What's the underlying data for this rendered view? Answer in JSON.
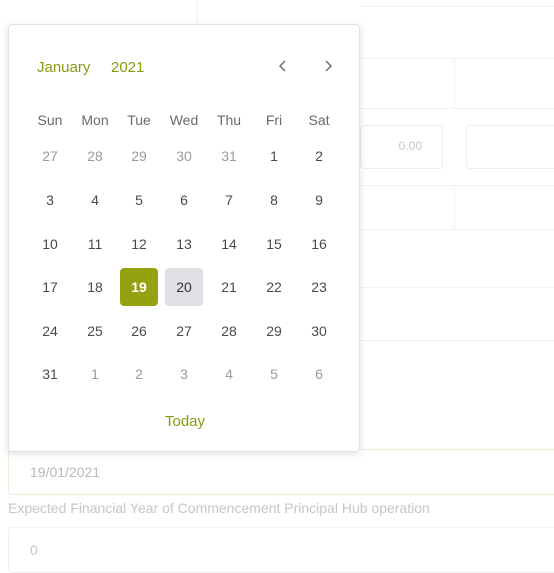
{
  "colors": {
    "accent": "#96a10f",
    "accent_text": "#8a9a0f",
    "hover_day": "#dfe0e3"
  },
  "picker": {
    "month": "January",
    "year": "2021",
    "prev_icon": "chevron-left-icon",
    "next_icon": "chevron-right-icon",
    "weekdays": [
      "Sun",
      "Mon",
      "Tue",
      "Wed",
      "Thu",
      "Fri",
      "Sat"
    ],
    "weeks": [
      [
        {
          "d": "27",
          "m": true
        },
        {
          "d": "28",
          "m": true
        },
        {
          "d": "29",
          "m": true
        },
        {
          "d": "30",
          "m": true
        },
        {
          "d": "31",
          "m": true
        },
        {
          "d": "1"
        },
        {
          "d": "2"
        }
      ],
      [
        {
          "d": "3"
        },
        {
          "d": "4"
        },
        {
          "d": "5"
        },
        {
          "d": "6"
        },
        {
          "d": "7"
        },
        {
          "d": "8"
        },
        {
          "d": "9"
        }
      ],
      [
        {
          "d": "10"
        },
        {
          "d": "11"
        },
        {
          "d": "12"
        },
        {
          "d": "13"
        },
        {
          "d": "14"
        },
        {
          "d": "15"
        },
        {
          "d": "16"
        }
      ],
      [
        {
          "d": "17"
        },
        {
          "d": "18"
        },
        {
          "d": "19",
          "s": true
        },
        {
          "d": "20",
          "h": true
        },
        {
          "d": "21"
        },
        {
          "d": "22"
        },
        {
          "d": "23"
        }
      ],
      [
        {
          "d": "24"
        },
        {
          "d": "25"
        },
        {
          "d": "26"
        },
        {
          "d": "27"
        },
        {
          "d": "28"
        },
        {
          "d": "29"
        },
        {
          "d": "30"
        }
      ],
      [
        {
          "d": "31"
        },
        {
          "d": "1",
          "m": true
        },
        {
          "d": "2",
          "m": true
        },
        {
          "d": "3",
          "m": true
        },
        {
          "d": "4",
          "m": true
        },
        {
          "d": "5",
          "m": true
        },
        {
          "d": "6",
          "m": true
        }
      ]
    ],
    "today_label": "Today"
  },
  "background": {
    "amount_value": "0.00"
  },
  "form": {
    "date_value": "19/01/2021",
    "commencement_label": "Expected Financial Year of Commencement Principal Hub operation",
    "commencement_value": "0"
  }
}
